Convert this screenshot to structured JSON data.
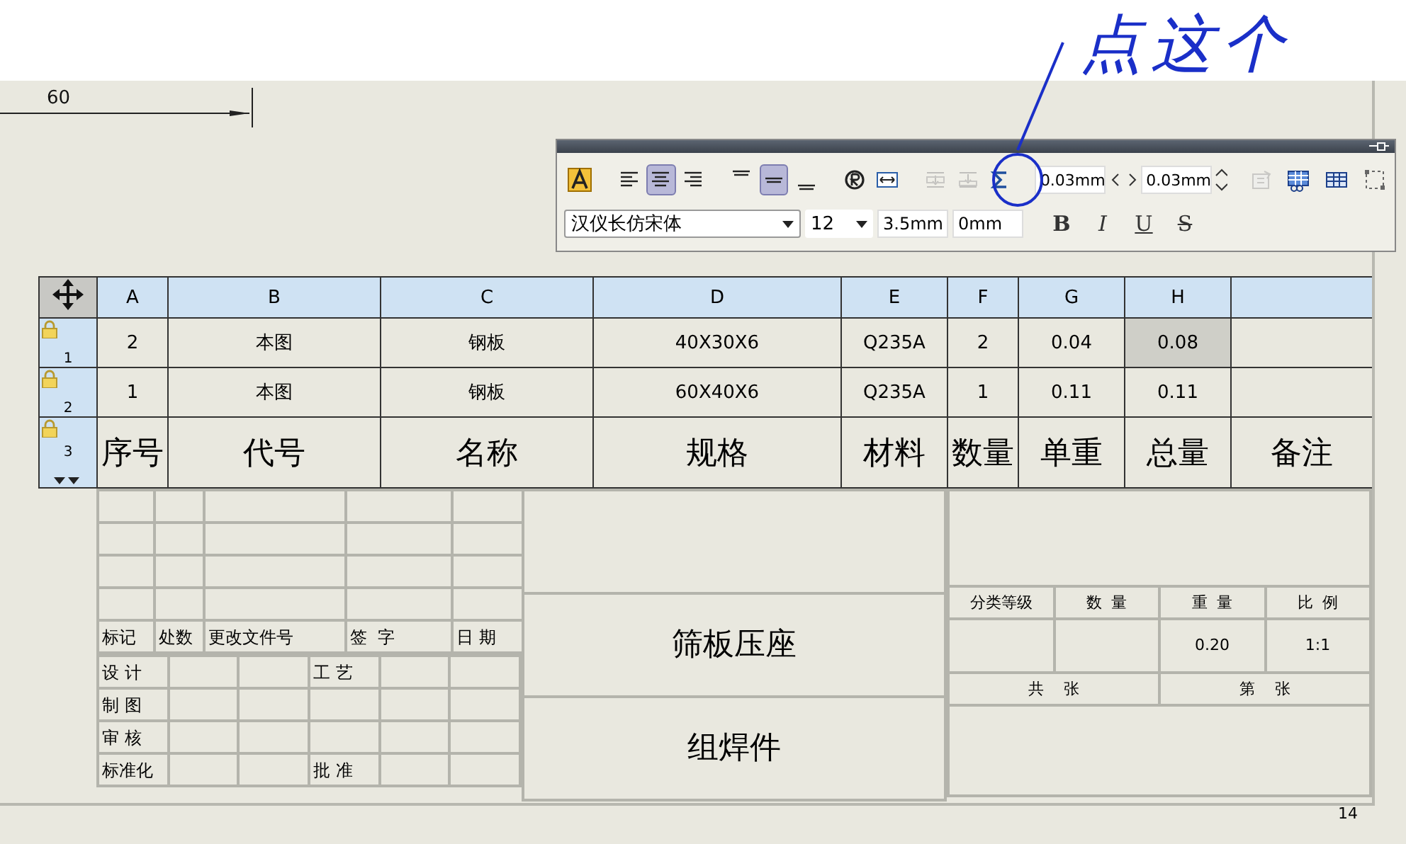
{
  "dimension": {
    "label": "60"
  },
  "annotation": {
    "text": "点这个"
  },
  "toolbar": {
    "align_buttons": [
      {
        "selected": false
      },
      {
        "selected": true
      },
      {
        "selected": false
      }
    ],
    "valign_buttons": [
      {
        "selected": false
      },
      {
        "selected": true
      },
      {
        "selected": false
      }
    ],
    "tool_buttons": [
      {
        "disabled": false
      },
      {
        "disabled": false
      },
      {
        "disabled": true
      },
      {
        "disabled": true
      },
      {
        "disabled": false
      }
    ],
    "spacing_h": "0.03mm",
    "spacing_v": "0.03mm",
    "right_buttons": [
      {
        "disabled": true
      },
      {
        "disabled": false
      },
      {
        "disabled": false
      },
      {
        "disabled": false
      }
    ],
    "font": "汉仪长仿宋体",
    "size": "12",
    "text_height": "3.5mm",
    "offset": "0mm",
    "format_buttons": [
      {
        "label": "B",
        "kind": "bold"
      },
      {
        "label": "I",
        "kind": "italic"
      },
      {
        "label": "U",
        "kind": "underline"
      },
      {
        "label": "S",
        "kind": "strike"
      }
    ]
  },
  "table": {
    "columns": [
      "A",
      "B",
      "C",
      "D",
      "E",
      "F",
      "G",
      "H"
    ],
    "rows": [
      {
        "number": "1",
        "locked": true,
        "kind": "data",
        "cells": [
          {
            "text": "2",
            "selected": false
          },
          {
            "text": "本图",
            "selected": false
          },
          {
            "text": "钢板",
            "selected": false
          },
          {
            "text": "40X30X6",
            "selected": false
          },
          {
            "text": "Q235A",
            "selected": false
          },
          {
            "text": "2",
            "selected": false
          },
          {
            "text": "0.04",
            "selected": false
          },
          {
            "text": "0.08",
            "selected": true
          },
          {
            "selected": false
          }
        ]
      },
      {
        "number": "2",
        "locked": true,
        "kind": "data",
        "cells": [
          {
            "text": "1",
            "selected": false
          },
          {
            "text": "本图",
            "selected": false
          },
          {
            "text": "钢板",
            "selected": false
          },
          {
            "text": "60X40X6",
            "selected": false
          },
          {
            "text": "Q235A",
            "selected": false
          },
          {
            "text": "1",
            "selected": false
          },
          {
            "text": "0.11",
            "selected": false
          },
          {
            "text": "0.11",
            "selected": false
          },
          {
            "selected": false
          }
        ]
      },
      {
        "number": "3",
        "locked": true,
        "kind": "heading",
        "cells": [
          {
            "text": "序号",
            "selected": false
          },
          {
            "text": "代号",
            "selected": false
          },
          {
            "text": "名称",
            "selected": false
          },
          {
            "text": "规格",
            "selected": false
          },
          {
            "text": "材料",
            "selected": false
          },
          {
            "text": "数量",
            "selected": false
          },
          {
            "text": "单重",
            "selected": false
          },
          {
            "text": "总量",
            "selected": false
          },
          {
            "text": "备注",
            "selected": false
          }
        ]
      }
    ]
  },
  "title_block": {
    "revision_headers": [
      "标记",
      "处数",
      "更改文件号",
      "签  字",
      "日 期"
    ],
    "signoffs": [
      {
        "label": "设 计",
        "role": "工 艺"
      },
      {
        "label": "制 图"
      },
      {
        "label": "审 核"
      },
      {
        "label": "标准化",
        "role": "批 准"
      }
    ],
    "part_name": "筛板压座",
    "drawing_type": "组焊件",
    "info_headers": [
      "分类等级",
      "数  量",
      "重  量",
      "比  例"
    ],
    "weight": "0.20",
    "scale": "1:1",
    "sheets_total": "共    张",
    "sheet_number": "第    张"
  },
  "page_number": "14"
}
